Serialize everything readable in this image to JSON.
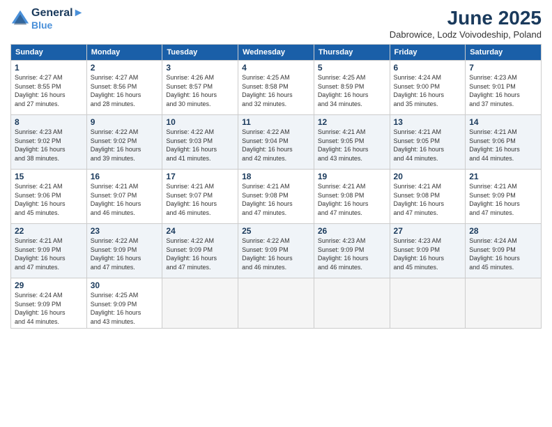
{
  "header": {
    "logo_line1": "General",
    "logo_line2": "Blue",
    "month": "June 2025",
    "location": "Dabrowice, Lodz Voivodeship, Poland"
  },
  "days_of_week": [
    "Sunday",
    "Monday",
    "Tuesday",
    "Wednesday",
    "Thursday",
    "Friday",
    "Saturday"
  ],
  "weeks": [
    [
      {
        "day": "1",
        "info": "Sunrise: 4:27 AM\nSunset: 8:55 PM\nDaylight: 16 hours\nand 27 minutes."
      },
      {
        "day": "2",
        "info": "Sunrise: 4:27 AM\nSunset: 8:56 PM\nDaylight: 16 hours\nand 28 minutes."
      },
      {
        "day": "3",
        "info": "Sunrise: 4:26 AM\nSunset: 8:57 PM\nDaylight: 16 hours\nand 30 minutes."
      },
      {
        "day": "4",
        "info": "Sunrise: 4:25 AM\nSunset: 8:58 PM\nDaylight: 16 hours\nand 32 minutes."
      },
      {
        "day": "5",
        "info": "Sunrise: 4:25 AM\nSunset: 8:59 PM\nDaylight: 16 hours\nand 34 minutes."
      },
      {
        "day": "6",
        "info": "Sunrise: 4:24 AM\nSunset: 9:00 PM\nDaylight: 16 hours\nand 35 minutes."
      },
      {
        "day": "7",
        "info": "Sunrise: 4:23 AM\nSunset: 9:01 PM\nDaylight: 16 hours\nand 37 minutes."
      }
    ],
    [
      {
        "day": "8",
        "info": "Sunrise: 4:23 AM\nSunset: 9:02 PM\nDaylight: 16 hours\nand 38 minutes."
      },
      {
        "day": "9",
        "info": "Sunrise: 4:22 AM\nSunset: 9:02 PM\nDaylight: 16 hours\nand 39 minutes."
      },
      {
        "day": "10",
        "info": "Sunrise: 4:22 AM\nSunset: 9:03 PM\nDaylight: 16 hours\nand 41 minutes."
      },
      {
        "day": "11",
        "info": "Sunrise: 4:22 AM\nSunset: 9:04 PM\nDaylight: 16 hours\nand 42 minutes."
      },
      {
        "day": "12",
        "info": "Sunrise: 4:21 AM\nSunset: 9:05 PM\nDaylight: 16 hours\nand 43 minutes."
      },
      {
        "day": "13",
        "info": "Sunrise: 4:21 AM\nSunset: 9:05 PM\nDaylight: 16 hours\nand 44 minutes."
      },
      {
        "day": "14",
        "info": "Sunrise: 4:21 AM\nSunset: 9:06 PM\nDaylight: 16 hours\nand 44 minutes."
      }
    ],
    [
      {
        "day": "15",
        "info": "Sunrise: 4:21 AM\nSunset: 9:06 PM\nDaylight: 16 hours\nand 45 minutes."
      },
      {
        "day": "16",
        "info": "Sunrise: 4:21 AM\nSunset: 9:07 PM\nDaylight: 16 hours\nand 46 minutes."
      },
      {
        "day": "17",
        "info": "Sunrise: 4:21 AM\nSunset: 9:07 PM\nDaylight: 16 hours\nand 46 minutes."
      },
      {
        "day": "18",
        "info": "Sunrise: 4:21 AM\nSunset: 9:08 PM\nDaylight: 16 hours\nand 47 minutes."
      },
      {
        "day": "19",
        "info": "Sunrise: 4:21 AM\nSunset: 9:08 PM\nDaylight: 16 hours\nand 47 minutes."
      },
      {
        "day": "20",
        "info": "Sunrise: 4:21 AM\nSunset: 9:08 PM\nDaylight: 16 hours\nand 47 minutes."
      },
      {
        "day": "21",
        "info": "Sunrise: 4:21 AM\nSunset: 9:09 PM\nDaylight: 16 hours\nand 47 minutes."
      }
    ],
    [
      {
        "day": "22",
        "info": "Sunrise: 4:21 AM\nSunset: 9:09 PM\nDaylight: 16 hours\nand 47 minutes."
      },
      {
        "day": "23",
        "info": "Sunrise: 4:22 AM\nSunset: 9:09 PM\nDaylight: 16 hours\nand 47 minutes."
      },
      {
        "day": "24",
        "info": "Sunrise: 4:22 AM\nSunset: 9:09 PM\nDaylight: 16 hours\nand 47 minutes."
      },
      {
        "day": "25",
        "info": "Sunrise: 4:22 AM\nSunset: 9:09 PM\nDaylight: 16 hours\nand 46 minutes."
      },
      {
        "day": "26",
        "info": "Sunrise: 4:23 AM\nSunset: 9:09 PM\nDaylight: 16 hours\nand 46 minutes."
      },
      {
        "day": "27",
        "info": "Sunrise: 4:23 AM\nSunset: 9:09 PM\nDaylight: 16 hours\nand 45 minutes."
      },
      {
        "day": "28",
        "info": "Sunrise: 4:24 AM\nSunset: 9:09 PM\nDaylight: 16 hours\nand 45 minutes."
      }
    ],
    [
      {
        "day": "29",
        "info": "Sunrise: 4:24 AM\nSunset: 9:09 PM\nDaylight: 16 hours\nand 44 minutes."
      },
      {
        "day": "30",
        "info": "Sunrise: 4:25 AM\nSunset: 9:09 PM\nDaylight: 16 hours\nand 43 minutes."
      },
      {
        "day": "",
        "info": ""
      },
      {
        "day": "",
        "info": ""
      },
      {
        "day": "",
        "info": ""
      },
      {
        "day": "",
        "info": ""
      },
      {
        "day": "",
        "info": ""
      }
    ]
  ]
}
